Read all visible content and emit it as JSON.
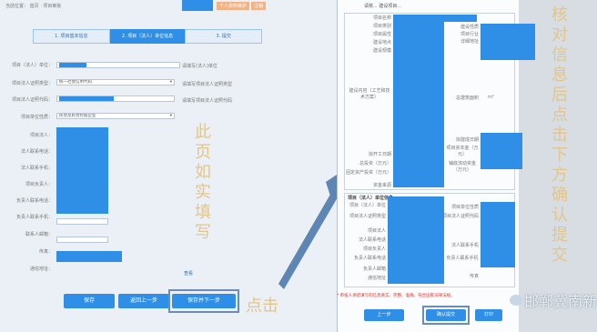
{
  "left": {
    "location_label": "当前位置：",
    "breadcrumb": "首页 · 项目审批",
    "top_links": [
      "个人资料维护",
      "注销"
    ],
    "steps": [
      "1. 项目基本信息",
      "2. 项目（法人）单位信息",
      "3. 提交"
    ],
    "field_labels": [
      "项目（法人）单位：",
      "项目法人证照类型：",
      "项目法人证照代码：",
      "项目单位性质：",
      "项目法人：",
      "法人联系电话：",
      "法人联系手机：",
      "项目负责人：",
      "负责人联系电话：",
      "负责人联系手机：",
      "联系人邮箱：",
      "传真：",
      "通信地址："
    ],
    "field_values": {
      "cert_type": "统一社会信用代码",
      "unit_nature": "民营及民营控股企业"
    },
    "side_notes": [
      "请填写(法人)单位",
      "请填写项目法人证照类型",
      "请填写项目法人证照代码"
    ],
    "link_more": "查看",
    "buttons": [
      "保存",
      "返回上一步",
      "保存并下一步"
    ],
    "annotation_fill": "此页如实填写",
    "annotation_click": "点击"
  },
  "right": {
    "notice": "请核... 建设项目...",
    "rows_left": [
      "项目名称",
      "项目类别",
      "项目属性",
      "建设地点",
      "建设规模"
    ],
    "rows_right": [
      "建设性质",
      "项目行业",
      "详细地址"
    ],
    "content_label": "建设内容（工艺和技术方案）",
    "area_label": "总建筑面积",
    "area_unit": "m²",
    "date_labels": [
      "拟开工日期",
      "总投资（万元）",
      "固定资产投资（万元）",
      "资金来源"
    ],
    "date_labels_right": [
      "拟建成日期",
      "项目资本金（万元）",
      "铺底流动资金（万元）"
    ],
    "section_title": "项目（法人）单位信息",
    "unit_left": [
      "项目（法人）单位",
      "项目法人证照类型",
      "项目法人",
      "法人联系电话",
      "项目负责人",
      "负责人联系电话",
      "负责人邮箱",
      "通信地址"
    ],
    "unit_right": [
      "项目单位性质",
      "项目法人证照代码",
      "法人联系手机",
      "负责人联系手机",
      "传真"
    ],
    "warning": "* 审核人承诺填写的信息真实、完整、准确，符合国家法律法规。",
    "buttons": [
      "上一步",
      "确认提交",
      "打印"
    ],
    "annotation_verify": "核对信息后点击下方确认提交",
    "watermark": "邯郸冀南新"
  },
  "colors": {
    "accent": "#2f8ee6",
    "annotation": "#e2c58a"
  }
}
